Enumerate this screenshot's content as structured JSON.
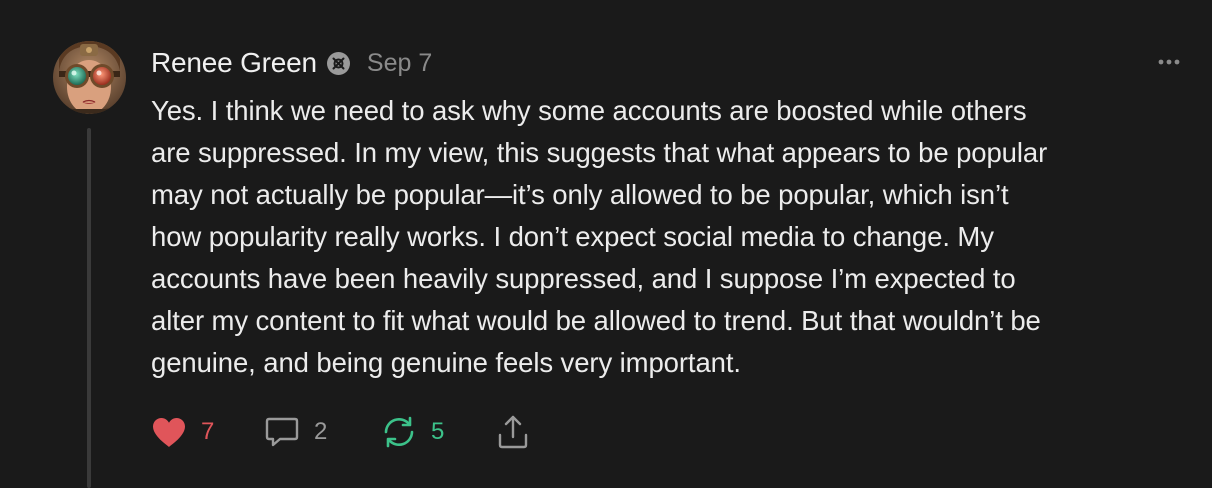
{
  "post": {
    "author": "Renee Green",
    "date": "Sep 7",
    "body_lines": [
      "Yes. I think we need to ask why some accounts are boosted while others",
      "are suppressed. In my view, this suggests that what appears to be popular",
      "may not actually be popular—it’s only allowed to be popular, which isn’t",
      "how popularity really works. I don’t expect social media to change. My",
      "accounts have been heavily suppressed, and I suppose I’m expected to",
      "alter my content to fit what would be allowed to trend. But that wouldn’t be",
      "genuine, and being genuine feels very important."
    ]
  },
  "actions": {
    "likes": "7",
    "replies": "2",
    "restacks": "5"
  },
  "icons": {
    "badge": "subscriber-badge-icon",
    "more": "more-dots-icon",
    "like": "heart-icon",
    "reply": "comment-bubble-icon",
    "restack": "restack-arrows-icon",
    "share": "share-upload-icon"
  },
  "colors": {
    "background": "#1a1a1a",
    "text": "#ececec",
    "muted": "#8a8a8a",
    "like": "#e0555a",
    "restack": "#3cc28a"
  }
}
